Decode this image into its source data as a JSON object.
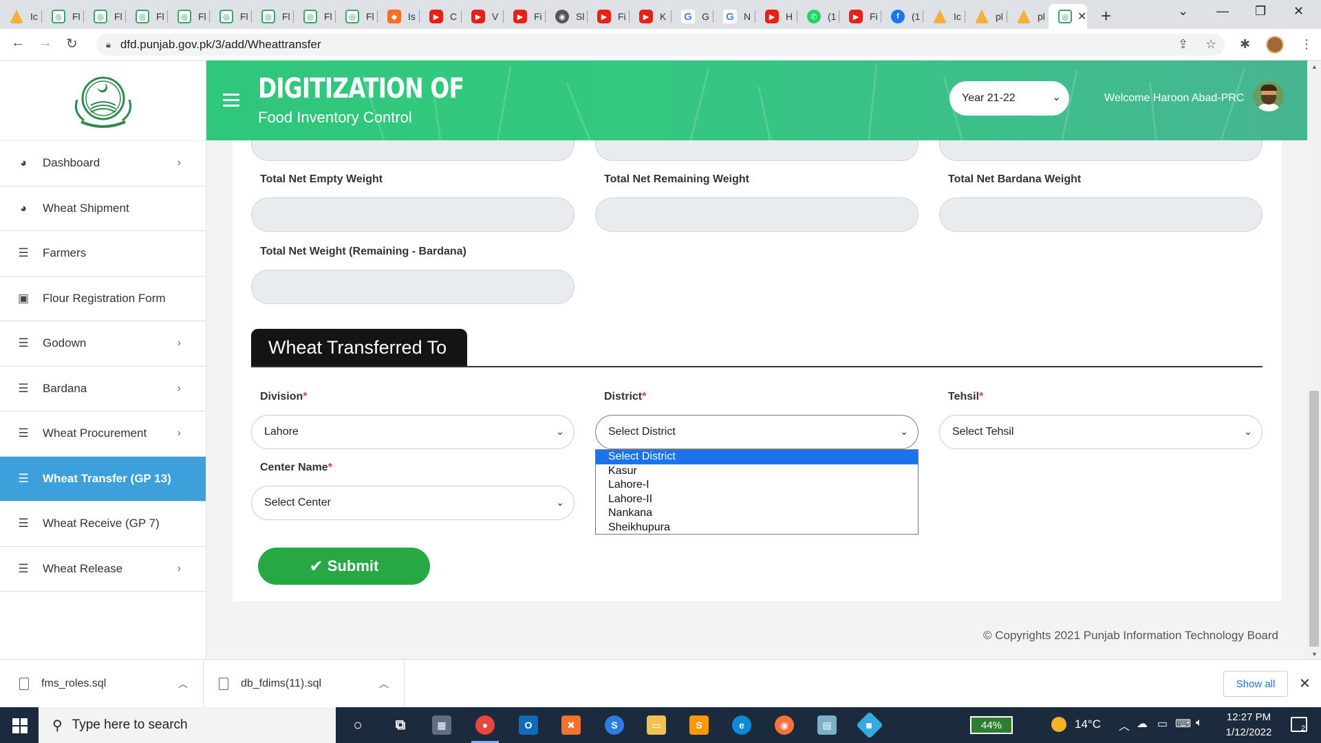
{
  "browser": {
    "tabs": [
      {
        "icon": "pma-icon",
        "label": "Ic"
      },
      {
        "icon": "punjab-logo-icon",
        "label": "Fl"
      },
      {
        "icon": "punjab-logo-icon",
        "label": "Fl"
      },
      {
        "icon": "punjab-logo-icon",
        "label": "Fl"
      },
      {
        "icon": "punjab-logo-icon",
        "label": "Fl"
      },
      {
        "icon": "punjab-logo-icon",
        "label": "Fl"
      },
      {
        "icon": "punjab-logo-icon",
        "label": "Fl"
      },
      {
        "icon": "punjab-logo-icon",
        "label": "Fl"
      },
      {
        "icon": "punjab-logo-icon",
        "label": "Fl"
      },
      {
        "icon": "gitlab-icon",
        "label": "Is"
      },
      {
        "icon": "youtube-icon",
        "label": "C"
      },
      {
        "icon": "youtube-icon",
        "label": "V"
      },
      {
        "icon": "youtube-icon",
        "label": "Fi"
      },
      {
        "icon": "github-icon",
        "label": "Sl"
      },
      {
        "icon": "youtube-icon",
        "label": "Fi"
      },
      {
        "icon": "youtube-icon",
        "label": "K"
      },
      {
        "icon": "google-icon",
        "label": "G"
      },
      {
        "icon": "google-icon",
        "label": "N"
      },
      {
        "icon": "youtube-icon",
        "label": "H"
      },
      {
        "icon": "whatsapp-icon",
        "label": "(1"
      },
      {
        "icon": "youtube-icon",
        "label": "Fi"
      },
      {
        "icon": "facebook-icon",
        "label": "(1"
      },
      {
        "icon": "pma-icon",
        "label": "Ic"
      },
      {
        "icon": "pma-icon",
        "label": "pl"
      },
      {
        "icon": "pma-icon",
        "label": "pl"
      }
    ],
    "url": "dfd.punjab.gov.pk/3/add/Wheattransfer"
  },
  "header": {
    "title": "DIGITIZATION OF",
    "subtitle": "Food Inventory Control",
    "year_select": "Year 21-22",
    "welcome": "Welcome Haroon Abad-PRC"
  },
  "sidebar": {
    "items": [
      {
        "label": "Dashboard",
        "icon": "pie-chart-icon",
        "chevron": true,
        "active": false
      },
      {
        "label": "Wheat Shipment",
        "icon": "pie-chart-icon",
        "chevron": false,
        "active": false
      },
      {
        "label": "Farmers",
        "icon": "list-icon",
        "chevron": false,
        "active": false
      },
      {
        "label": "Flour Registration Form",
        "icon": "clipboard-icon",
        "chevron": false,
        "active": false
      },
      {
        "label": "Godown",
        "icon": "list-icon",
        "chevron": true,
        "active": false
      },
      {
        "label": "Bardana",
        "icon": "list-icon",
        "chevron": true,
        "active": false
      },
      {
        "label": "Wheat Procurement",
        "icon": "list-icon",
        "chevron": true,
        "active": false
      },
      {
        "label": "Wheat Transfer (GP 13)",
        "icon": "list-icon",
        "chevron": false,
        "active": true
      },
      {
        "label": "Wheat Receive (GP 7)",
        "icon": "list-icon",
        "chevron": false,
        "active": false
      },
      {
        "label": "Wheat Release",
        "icon": "list-icon",
        "chevron": true,
        "active": false
      }
    ]
  },
  "form": {
    "labels": {
      "total_net_empty_weight": "Total Net Empty Weight",
      "total_net_remaining_weight": "Total Net Remaining Weight",
      "total_net_bardana_weight": "Total Net Bardana Weight",
      "total_net_weight": "Total Net Weight (Remaining - Bardana)"
    },
    "section_title": "Wheat Transferred To",
    "division": {
      "label": "Division",
      "value": "Lahore"
    },
    "district": {
      "label": "District",
      "value": "Select District",
      "options": [
        "Select District",
        "Kasur",
        "Lahore-I",
        "Lahore-II",
        "Nankana",
        "Sheikhupura"
      ]
    },
    "tehsil": {
      "label": "Tehsil",
      "value": "Select Tehsil"
    },
    "center": {
      "label": "Center Name",
      "value": "Select Center"
    },
    "required_mark": "*",
    "submit_label": "Submit"
  },
  "footer": {
    "copyright": "© Copyrights 2021 Punjab Information Technology Board"
  },
  "downloads": {
    "items": [
      "fms_roles.sql",
      "db_fdims(11).sql"
    ],
    "show_all": "Show all"
  },
  "taskbar": {
    "search_placeholder": "Type here to search",
    "battery": "44%",
    "temperature": "14°C",
    "time": "12:27 PM",
    "date": "1/12/2022",
    "notifications": "2"
  },
  "colors": {
    "banner": "#34c880",
    "active_menu": "#3ea0db",
    "submit": "#28a745",
    "required": "#e23b3b"
  }
}
